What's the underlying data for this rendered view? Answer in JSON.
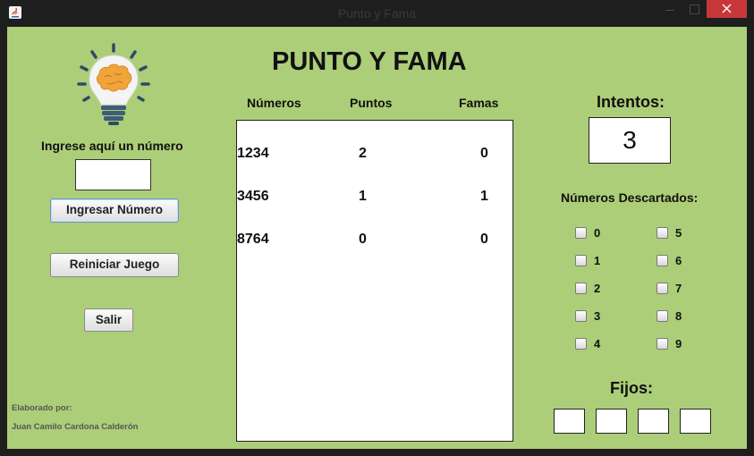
{
  "window": {
    "title": "Punto y Fama"
  },
  "main": {
    "heading": "PUNTO Y FAMA"
  },
  "left": {
    "prompt": "Ingrese aquí un número",
    "input_value": "",
    "ingresar_label": "Ingresar Número",
    "reiniciar_label": "Reiniciar Juego",
    "salir_label": "Salir",
    "credit_label": "Elaborado por:",
    "credit_name": "Juan Camilo Cardona Calderón"
  },
  "table": {
    "headers": [
      "Números",
      "Puntos",
      "Famas"
    ],
    "rows": [
      {
        "numero": "1234",
        "puntos": "2",
        "famas": "0"
      },
      {
        "numero": "3456",
        "puntos": "1",
        "famas": "1"
      },
      {
        "numero": "8764",
        "puntos": "0",
        "famas": "0"
      }
    ]
  },
  "right": {
    "intentos_label": "Intentos:",
    "intentos_value": "3",
    "descartados_label": "Números Descartados:",
    "digits": [
      "0",
      "1",
      "2",
      "3",
      "4",
      "5",
      "6",
      "7",
      "8",
      "9"
    ],
    "fijos_label": "Fijos:"
  },
  "colors": {
    "panel_background": "#acce78",
    "close_button": "#c7373a"
  },
  "icons": [
    "java-app-icon",
    "lightbulb-brain-icon"
  ]
}
